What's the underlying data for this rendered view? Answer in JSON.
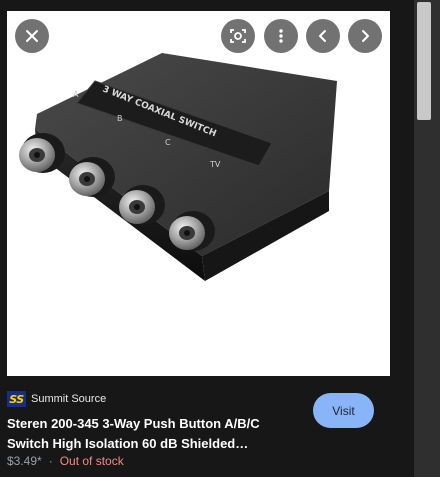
{
  "source": {
    "logo_text": "SS",
    "name": "Summit Source"
  },
  "product": {
    "title_line1": "Steren 200-345 3-Way Push Button A/B/C",
    "title_line2": "Switch High Isolation 60 dB Shielded…",
    "price": "$3.49*",
    "separator": "·",
    "stock": "Out of stock"
  },
  "image": {
    "label_text": "3 WAY COAXIAL SWITCH",
    "port_labels": [
      "A",
      "B",
      "C",
      "TV"
    ]
  },
  "buttons": {
    "visit_label": "Visit"
  },
  "icons": {
    "close": "close-icon",
    "lens": "lens-icon",
    "more": "more-vert-icon",
    "prev": "chevron-left-icon",
    "next": "chevron-right-icon"
  },
  "colors": {
    "background": "#171717",
    "visit_button": "#8ab4f8",
    "out_of_stock": "#f28b82",
    "logo_bg": "#1b2c84",
    "logo_text": "#ffd200"
  }
}
